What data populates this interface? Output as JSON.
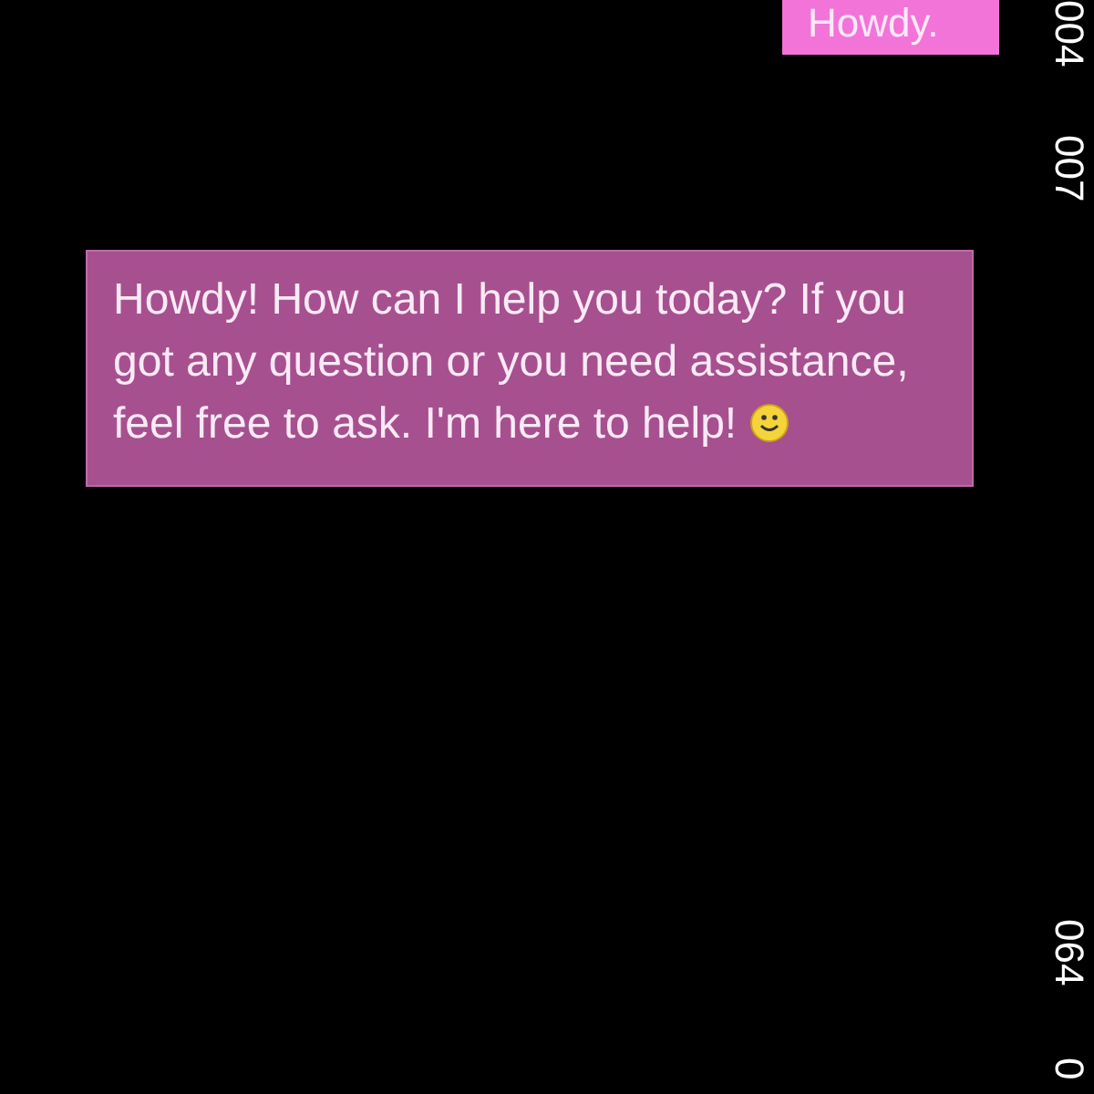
{
  "messages": [
    {
      "kind": "sent",
      "text": "Howdy.",
      "emoji": false
    },
    {
      "kind": "received",
      "text": " Howdy! How can I help you today? If you got any question or you need assistance, feel free to ask. I'm here to help!",
      "emoji": true
    }
  ],
  "side_labels": [
    "004",
    "007",
    "064",
    "0"
  ]
}
